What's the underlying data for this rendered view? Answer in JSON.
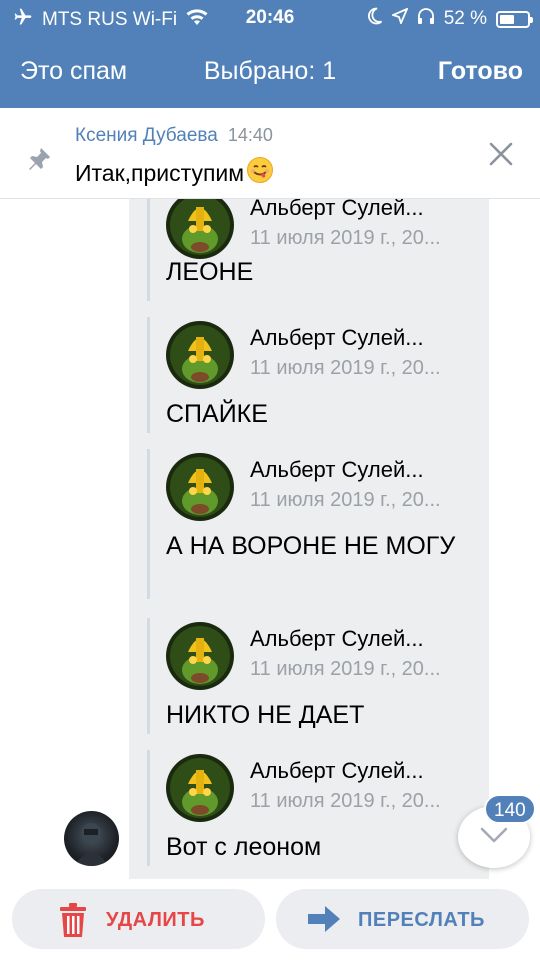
{
  "status_bar": {
    "carrier": "MTS RUS Wi-Fi",
    "time": "20:46",
    "battery": "52 %",
    "battery_level": 0.52
  },
  "navbar": {
    "left": "Это спам",
    "title": "Выбрано: 1",
    "right": "Готово"
  },
  "pinned": {
    "author": "Ксения Дубаева",
    "time": "14:40",
    "text": "Итак,приступим"
  },
  "forwarded": [
    {
      "name": "Альберт Сулей...",
      "date": "11 июля 2019 г., 20...",
      "text": "ЛЕОНЕ"
    },
    {
      "name": "Альберт Сулей...",
      "date": "11 июля 2019 г., 20...",
      "text": "СПАЙКЕ"
    },
    {
      "name": "Альберт Сулей...",
      "date": "11 июля 2019 г., 20...",
      "text": "А НА ВОРОНЕ НЕ МОГУ"
    },
    {
      "name": "Альберт Сулей...",
      "date": "11 июля 2019 г., 20...",
      "text": "НИКТО НЕ ДАЕТ"
    },
    {
      "name": "Альберт Сулей...",
      "date": "11 июля 2019 г., 20...",
      "text": "Вот с леоном"
    }
  ],
  "unread_badge": "140",
  "actions": {
    "delete": "УДАЛИТЬ",
    "forward": "ПЕРЕСЛАТЬ"
  },
  "colors": {
    "header": "#5181b8",
    "selection": "#edeef0",
    "delete": "#e64646",
    "accent": "#5181b8"
  }
}
